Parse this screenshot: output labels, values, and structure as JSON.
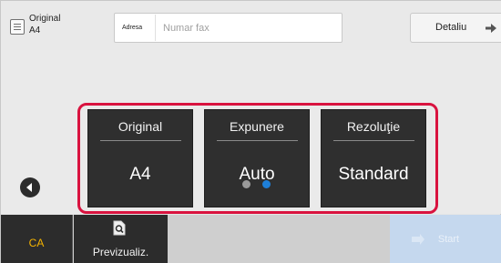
{
  "original_info": {
    "line1": "Original",
    "line2": "A4",
    "icon": "document-icon"
  },
  "address": {
    "label": "Adresa",
    "placeholder": "Numar fax"
  },
  "detail_button": {
    "label": "Detaliu",
    "icon": "arrow-right-icon"
  },
  "cards": [
    {
      "title": "Original",
      "value": "A4"
    },
    {
      "title": "Expunere",
      "value": "Auto"
    },
    {
      "title": "Rezoluţie",
      "value": "Standard"
    }
  ],
  "pagination": {
    "pages": 2,
    "current": 2
  },
  "bottom": {
    "ca_label": "CA",
    "preview_label": "Previzualiz.",
    "preview_icon": "preview-magnifier-icon",
    "start_label": "Start",
    "start_icon": "start-icon"
  },
  "colors": {
    "highlight": "#d9133f",
    "ca_text": "#f5b400",
    "dot_active": "#1e7fd8",
    "dot_inactive": "#9a9a9a",
    "start_disabled": "#c5d8ee"
  }
}
